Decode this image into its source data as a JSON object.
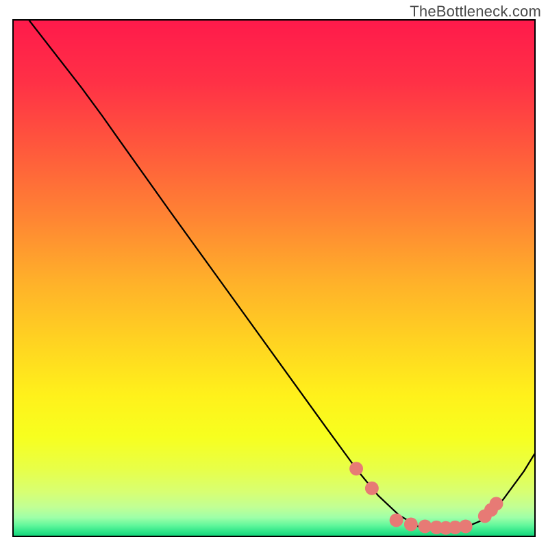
{
  "attribution": "TheBottleneck.com",
  "chart_data": {
    "type": "line",
    "title": "",
    "xlabel": "",
    "ylabel": "",
    "x_range_fraction": [
      0.0,
      1.0
    ],
    "y_range_fraction": [
      0.0,
      1.0
    ],
    "curve": {
      "comment": "Black curve; x and y in plot-area fractions (0=left/bottom, 1=right/top).",
      "x_frac": [
        0.03,
        0.13,
        0.17,
        0.2,
        0.3,
        0.4,
        0.5,
        0.6,
        0.66,
        0.7,
        0.74,
        0.78,
        0.82,
        0.86,
        0.9,
        0.94,
        0.98,
        1.0
      ],
      "y_frac": [
        1.0,
        0.87,
        0.815,
        0.772,
        0.63,
        0.49,
        0.35,
        0.21,
        0.127,
        0.078,
        0.04,
        0.016,
        0.01,
        0.013,
        0.03,
        0.07,
        0.125,
        0.158
      ]
    },
    "marker_series": {
      "comment": "Salmon dots near the trough.",
      "color": "#e77a75",
      "radius_px": 10,
      "x_frac": [
        0.658,
        0.688,
        0.735,
        0.763,
        0.79,
        0.812,
        0.83,
        0.848,
        0.868,
        0.905,
        0.917,
        0.927
      ],
      "y_frac": [
        0.13,
        0.092,
        0.03,
        0.022,
        0.018,
        0.016,
        0.015,
        0.016,
        0.018,
        0.038,
        0.05,
        0.062
      ]
    },
    "background_gradient": {
      "comment": "Vertical gradient, y_frac from top (0) to bottom (1).",
      "stops": [
        {
          "y": 0.0,
          "color": "#ff1a4b"
        },
        {
          "y": 0.12,
          "color": "#ff3146"
        },
        {
          "y": 0.25,
          "color": "#ff5a3c"
        },
        {
          "y": 0.38,
          "color": "#ff8533"
        },
        {
          "y": 0.5,
          "color": "#ffb02a"
        },
        {
          "y": 0.62,
          "color": "#ffd421"
        },
        {
          "y": 0.72,
          "color": "#fff11b"
        },
        {
          "y": 0.8,
          "color": "#f7ff1f"
        },
        {
          "y": 0.86,
          "color": "#e8ff47"
        },
        {
          "y": 0.905,
          "color": "#d8ff72"
        },
        {
          "y": 0.935,
          "color": "#c1ff95"
        },
        {
          "y": 0.955,
          "color": "#9dffa8"
        },
        {
          "y": 0.97,
          "color": "#60f79b"
        },
        {
          "y": 0.982,
          "color": "#2de488"
        },
        {
          "y": 0.992,
          "color": "#0fd178"
        },
        {
          "y": 1.0,
          "color": "#07c86f"
        }
      ]
    }
  }
}
